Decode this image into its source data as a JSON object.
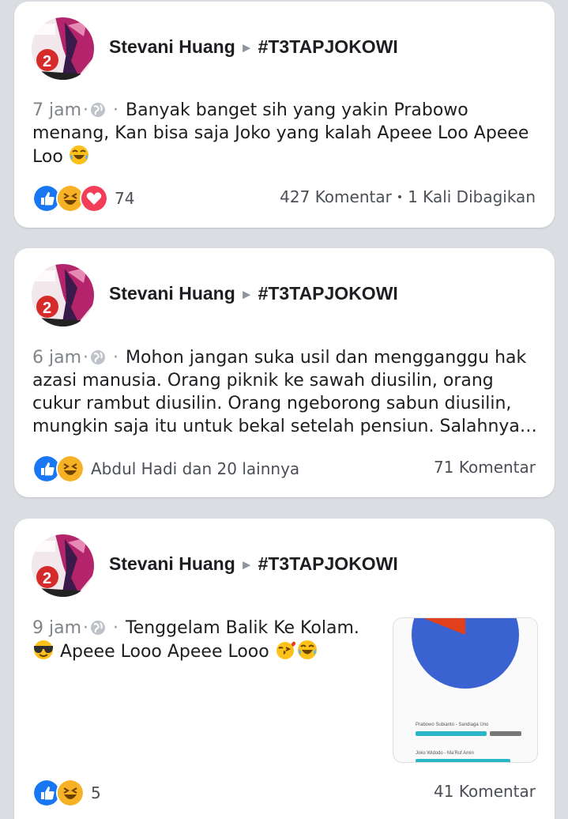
{
  "posts": [
    {
      "author": "Stevani Huang",
      "group": "#T3TAPJOKOWI",
      "time": "7 jam",
      "text": "Banyak banget sih yang yakin  Prabowo menang, Kan bisa saja Joko yang kalah Apeee Loo Apeee Loo",
      "reactions": [
        "like",
        "haha",
        "love"
      ],
      "reaction_summary": "74",
      "comments": "427 Komentar",
      "shares": "1 Kali Dibagikan"
    },
    {
      "author": "Stevani Huang",
      "group": "#T3TAPJOKOWI",
      "time": "6 jam",
      "text": "Mohon jangan suka usil dan mengganggu hak azasi manusia. Orang piknik ke sawah diusilin, orang cukur rambut diusilin. Orang ngeborong sabun diusilin, mungkin saja itu untuk bekal setelah pensiun. Salahnya…",
      "reactions": [
        "like",
        "haha"
      ],
      "reaction_summary": "Abdul Hadi dan 20 lainnya",
      "comments": "71 Komentar"
    },
    {
      "author": "Stevani Huang",
      "group": "#T3TAPJOKOWI",
      "time": "9 jam",
      "text_line1": "Tenggelam Balik Ke Kolam.",
      "text_line2": "Apeee Looo Apeee Looo",
      "reactions": [
        "like",
        "haha"
      ],
      "reaction_summary": "5",
      "comments": "41 Komentar",
      "attachment": {
        "legend_1": "Prabowo Subianto - Sandiaga Uno",
        "legend_2": "Joko Widodo - Ma'Ruf Amin",
        "colors": {
          "pie_main": "#3a63d1",
          "pie_slice": "#e2401c"
        }
      }
    }
  ],
  "colors": {
    "like": "#1877f2",
    "love": "#f33e58",
    "haha": "#f7b125",
    "background": "#dadde1"
  }
}
